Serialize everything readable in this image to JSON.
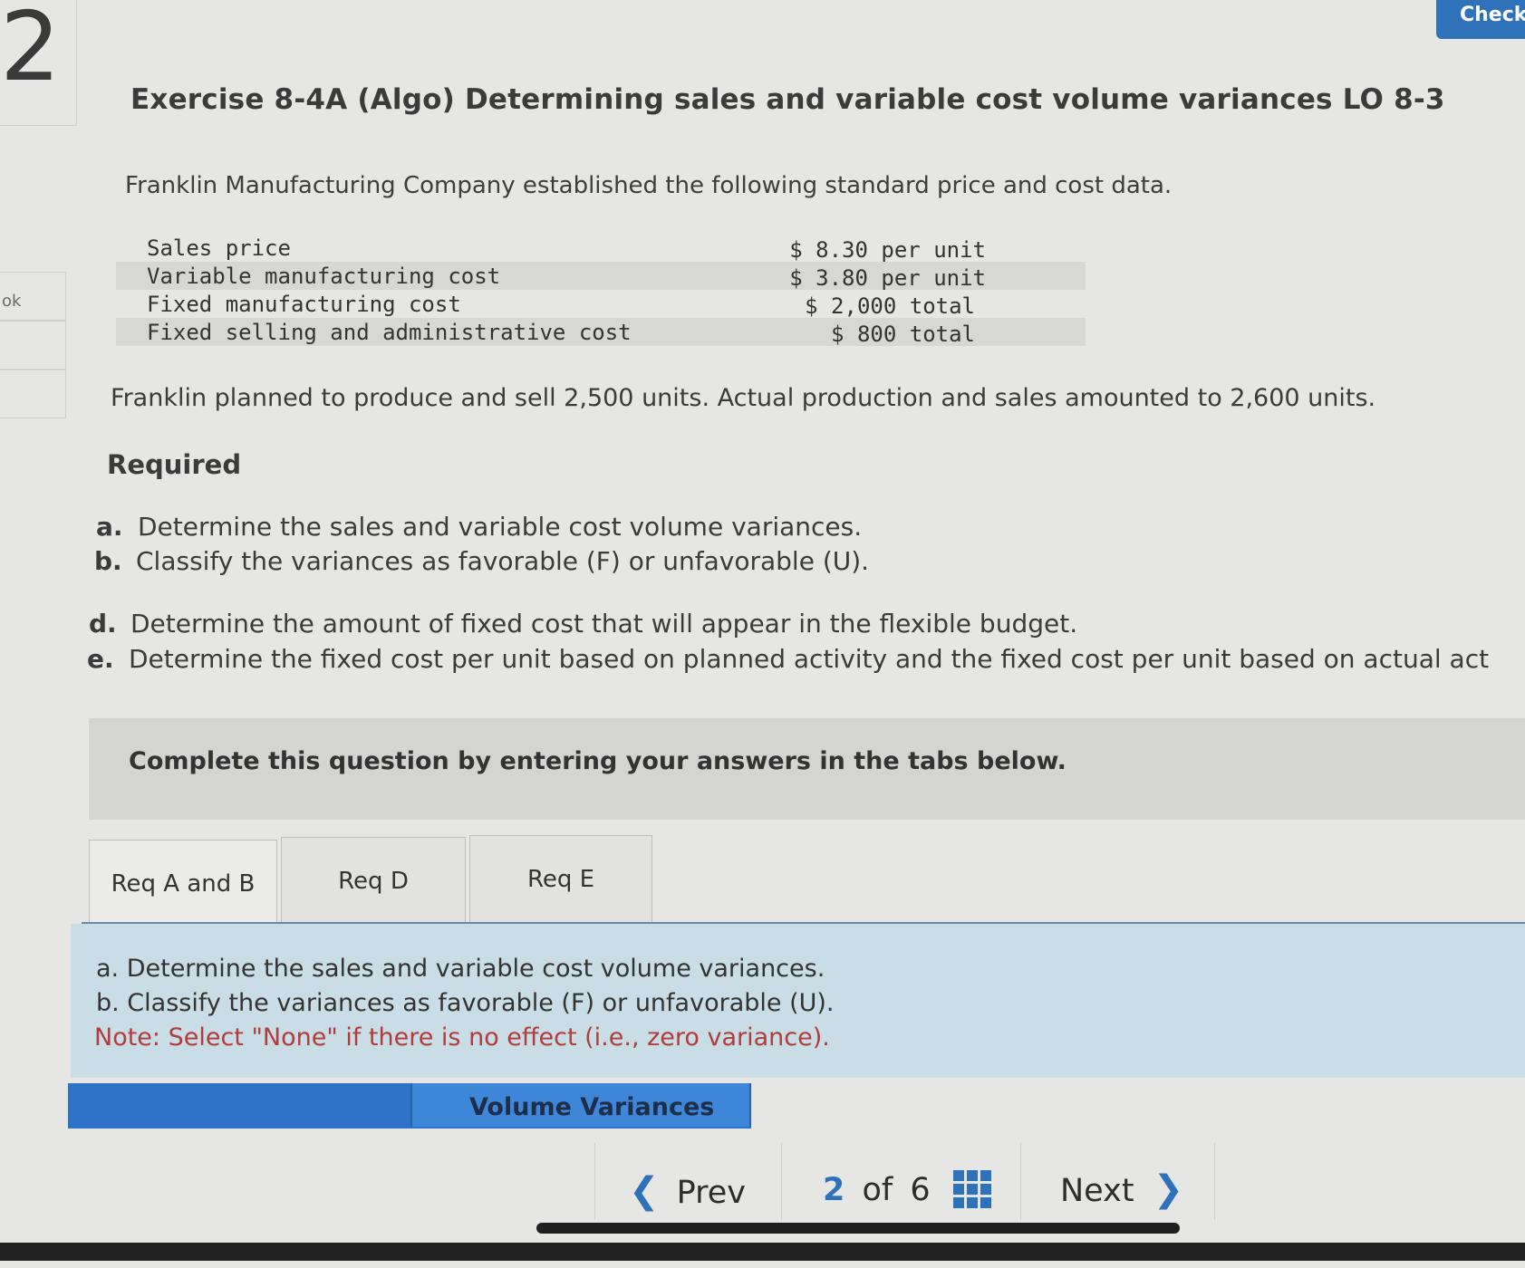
{
  "question_number": "2",
  "left_fragment": "ok",
  "header": {
    "check_label": "Check"
  },
  "title": "Exercise 8-4A (Algo) Determining sales and variable cost volume variances LO 8-3",
  "intro": "Franklin Manufacturing Company established the following standard price and cost data.",
  "cost_table": [
    {
      "label": "Sales price",
      "value": "$ 8.30 per unit"
    },
    {
      "label": "Variable manufacturing cost",
      "value": "$ 3.80 per unit"
    },
    {
      "label": "Fixed manufacturing cost",
      "value": "$ 2,000 total"
    },
    {
      "label": "Fixed selling and administrative cost",
      "value": "$ 800 total"
    }
  ],
  "planned_text": "Franklin planned to produce and sell 2,500 units. Actual production and sales amounted to 2,600 units.",
  "required_heading": "Required",
  "requirements": [
    {
      "letter": "a.",
      "text": "Determine the sales and variable cost volume variances."
    },
    {
      "letter": "b.",
      "text": "Classify the variances as favorable (F) or unfavorable (U)."
    },
    {
      "letter": "d.",
      "text": "Determine the amount of fixed cost that will appear in the flexible budget."
    },
    {
      "letter": "e.",
      "text": "Determine the fixed cost per unit based on planned activity and the fixed cost per unit based on actual act"
    }
  ],
  "instruction": "Complete this question by entering your answers in the tabs below.",
  "tabs": [
    {
      "label": "Req A and B",
      "active": true
    },
    {
      "label": "Req D",
      "active": false
    },
    {
      "label": "Req E",
      "active": false
    }
  ],
  "answer_panel": {
    "line_a": "a. Determine the sales and variable cost volume variances.",
    "line_b": "b. Classify the variances as favorable (F) or unfavorable (U).",
    "note": "Note: Select \"None\" if there is no effect (i.e., zero variance)."
  },
  "table_header": "Volume Variances",
  "navigation": {
    "prev_label": "Prev",
    "current_page": "2",
    "of_label": "of",
    "total_pages": "6",
    "next_label": "Next"
  },
  "colors": {
    "accent": "#2f72ba",
    "answer_panel_bg": "#c9dde6",
    "note_text": "#b23b3b",
    "table_header_bg": "#2e73c8"
  }
}
